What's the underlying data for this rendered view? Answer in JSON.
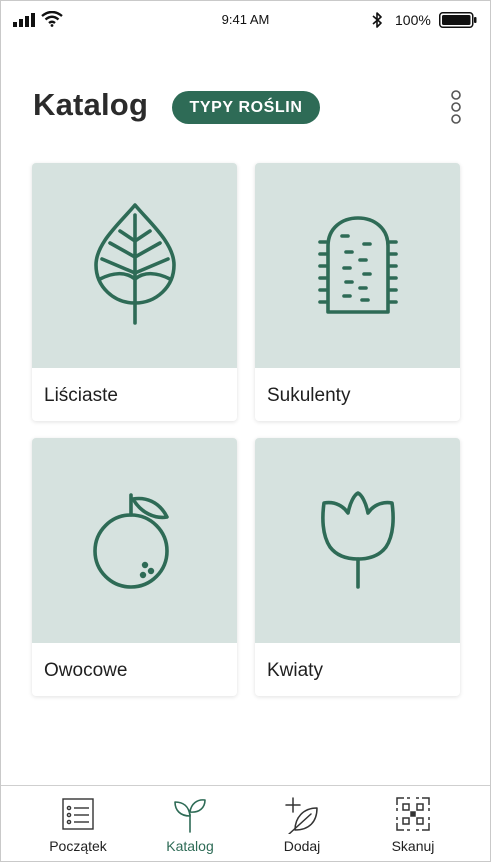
{
  "status_bar": {
    "time": "9:41 AM",
    "battery_percent": "100%",
    "icons": [
      "signal-icon",
      "wifi-icon",
      "bluetooth-icon",
      "battery-icon"
    ]
  },
  "header": {
    "title": "Katalog",
    "category_pill": "TYPY ROŚLIN",
    "menu_icon": "more-vertical-icon"
  },
  "categories": [
    {
      "label": "Liściaste",
      "icon": "leaf-icon"
    },
    {
      "label": "Sukulenty",
      "icon": "cactus-icon"
    },
    {
      "label": "Owocowe",
      "icon": "fruit-icon"
    },
    {
      "label": "Kwiaty",
      "icon": "tulip-icon"
    }
  ],
  "tabbar": {
    "tabs": [
      {
        "label": "Początek",
        "icon": "list-icon",
        "active": false
      },
      {
        "label": "Katalog",
        "icon": "sprout-icon",
        "active": true
      },
      {
        "label": "Dodaj",
        "icon": "add-leaf-icon",
        "active": false
      },
      {
        "label": "Skanuj",
        "icon": "qr-scan-icon",
        "active": false
      }
    ]
  },
  "colors": {
    "accent": "#2e6b56",
    "card_background": "#d6e2df",
    "icon_stroke": "#2e6b56"
  }
}
